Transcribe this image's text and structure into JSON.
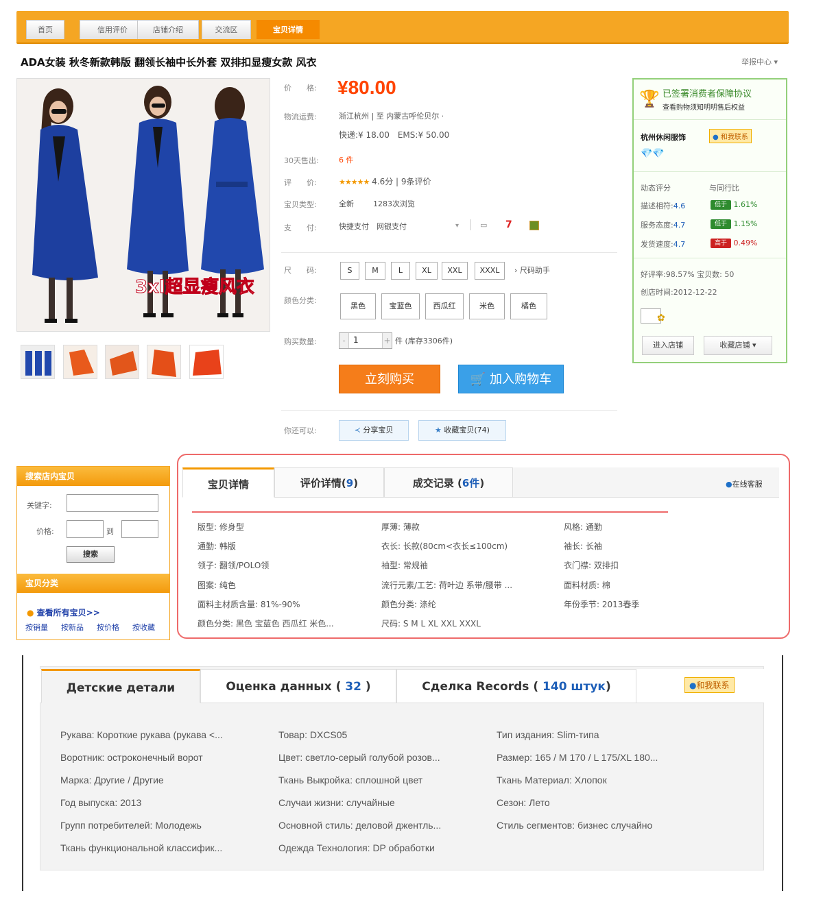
{
  "nav": {
    "tabs": [
      "首页",
      "信用评价",
      "店铺介绍",
      "交流区",
      "宝贝详情"
    ]
  },
  "product": {
    "title": "ADA女装 秋冬新款韩版 翻领长袖中长外套 双排扣显瘦女款 风衣",
    "report": "举报中心",
    "image_caption": "3xl超显瘦风衣"
  },
  "meta": {
    "price_label": "价　　格:",
    "price": "¥80.00",
    "logistics_label": "物流运费:",
    "logistics_route": "浙江杭州 | 至 内蒙古呼伦贝尔 ·",
    "logistics_fee": "快递:¥ 18.00　EMS:¥ 50.00",
    "sold_label": "30天售出:",
    "sold_value": "6 件",
    "rating_label": "评　　价:",
    "rating_stars": "★★★★★",
    "rating_value": "4.6分",
    "rating_count": "9条评价",
    "type_label": "宝贝类型:",
    "type_value": "全新",
    "views": "1283次浏览",
    "pay_label": "支　　付:",
    "pay_value": "快捷支付　网银支付",
    "size_label": "尺　　码:",
    "sizes": [
      "S",
      "M",
      "L",
      "XL",
      "XXL",
      "XXXL"
    ],
    "size_help": "› 尺码助手",
    "color_label": "颜色分类:",
    "colors": [
      "黑色",
      "宝蓝色",
      "西瓜红",
      "米色",
      "橘色"
    ],
    "qty_label": "购买数量:",
    "qty_value": "1",
    "qty_stock": "件 (库存3306件)",
    "buy_now": "立刻购买",
    "add_cart": "加入购物车",
    "share_label": "你还可以:",
    "share_btn": "分享宝贝",
    "fav_btn": "收藏宝贝(74)"
  },
  "shop": {
    "guarantee_title": "已签署消费者保障协议",
    "guarantee_sub": "查看购物须知明明售后权益",
    "name": "杭州休闲服饰",
    "contact": "和我联系",
    "dyn_label": "动态评分",
    "peer_label": "与同行比",
    "scores": [
      {
        "label": "描述相符:",
        "value": "4.6",
        "badge": "低于",
        "pct": "1.61%",
        "color": "#2e8b2e"
      },
      {
        "label": "服务态度:",
        "value": "4.7",
        "badge": "低于",
        "pct": "1.15%",
        "color": "#2e8b2e"
      },
      {
        "label": "发货速度:",
        "value": "4.7",
        "badge": "高于",
        "pct": "0.49%",
        "color": "#cc2222"
      }
    ],
    "good_rate": "好评率:98.57%",
    "items": "宝贝数: 50",
    "created": "创店时间:2012-12-22",
    "enter": "进入店铺",
    "fav_shop": "收藏店铺"
  },
  "search": {
    "title": "搜索店内宝贝",
    "kw_label": "关键字:",
    "price_label": "价格:",
    "to": "到",
    "btn": "搜索",
    "cat_title": "宝贝分类",
    "all_items": "查看所有宝贝>>",
    "sorts": [
      "按销量",
      "按新品",
      "按价格",
      "按收藏"
    ]
  },
  "detail_cn": {
    "tabs": [
      {
        "label": "宝贝详情"
      },
      {
        "label": "评价详情(",
        "num": "9",
        "suffix": ")"
      },
      {
        "label": "成交记录 (",
        "num": "6件",
        "suffix": ")"
      }
    ],
    "service": "在线客服",
    "attrs": [
      "版型: 修身型",
      "厚薄: 薄款",
      "风格: 通勤",
      "通勤: 韩版",
      "衣长: 长款(80cm<衣长≤100cm)",
      "袖长: 长袖",
      "领子: 翻领/POLO领",
      "袖型: 常规袖",
      "衣门襟: 双排扣",
      "图案: 纯色",
      "流行元素/工艺: 荷叶边 系带/腰带 ...",
      "面料材质: 棉",
      "面料主材质含量: 81%-90%",
      "颜色分类: 涤纶",
      "年份季节: 2013春季",
      "颜色分类: 黑色 宝蓝色 西瓜红 米色...",
      "尺码: S M L XL XXL XXXL",
      ""
    ]
  },
  "detail_ru": {
    "tabs": [
      {
        "label": "Детские детали"
      },
      {
        "label": "Оценка данных ( ",
        "num": "32",
        "suffix": " )"
      },
      {
        "label": "Сделка Records ( ",
        "num": "140 штук",
        "suffix": ")"
      }
    ],
    "contact": "和我联系",
    "attrs": [
      "Рукава: Короткие рукава (рукава <...",
      "Товар: DXCS05",
      "Тип издания: Slim-типа",
      "Воротник: остроконечный ворот",
      "Цвет: светло-серый голубой розов...",
      "Размер: 165 / M 170 / L 175/XL 180...",
      "Марка: Другие / Другие",
      "Ткань Выкройка: сплошной цвет",
      "Ткань Материал: Хлопок",
      "Год выпуска: 2013",
      "Случаи жизни: случайные",
      "Сезон: Лето",
      "Групп потребителей: Молодежь",
      "Основной стиль: деловой джентль...",
      "Стиль сегментов: бизнес случайно",
      "Ткань функциональной классифик...",
      "Одежда Технология: DP обработки",
      ""
    ]
  },
  "colors": {
    "orange": "#f5a623",
    "price": "#ff4400",
    "blue_link": "#1e5fb8",
    "red_border": "#ee6a6a",
    "green_border": "#93d07a"
  }
}
